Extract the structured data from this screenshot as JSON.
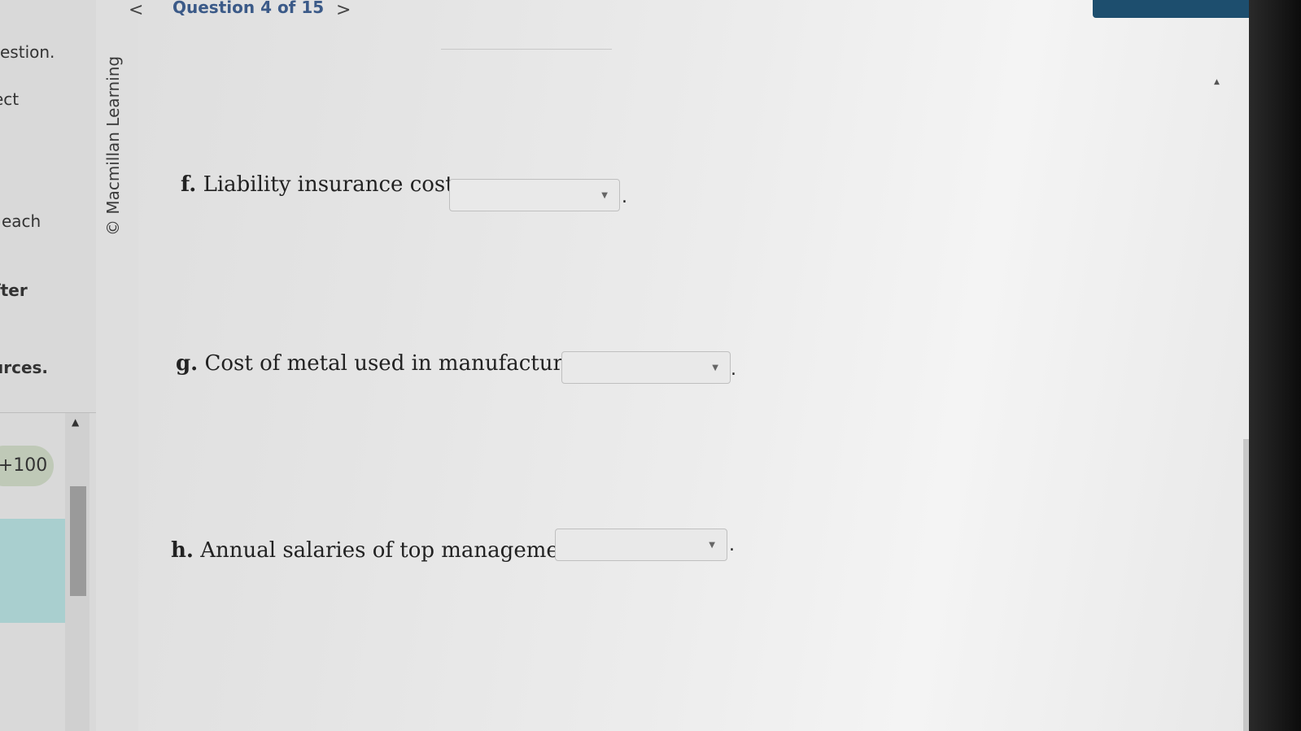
{
  "left_panel": {
    "line1": "estion.",
    "line2": "ect",
    "line3": "each",
    "line4": "fter",
    "line5": "urces.",
    "score": "+100"
  },
  "brand": "© Macmillan Learning",
  "nav": {
    "prev": "<",
    "title": "Question 4 of 15",
    "next": ">",
    "expand": "↗"
  },
  "questions": [
    {
      "letter": "f.",
      "text": "Liability insurance costs:",
      "selected": ""
    },
    {
      "letter": "g.",
      "text": "Cost of metal used in manufacturing:",
      "selected": ""
    },
    {
      "letter": "h.",
      "text": "Annual salaries of top management:",
      "selected": ""
    }
  ],
  "colors": {
    "accent": "#1d4e6e",
    "nav_title": "#3b5a88",
    "score_pill": "#bfc9b7"
  }
}
